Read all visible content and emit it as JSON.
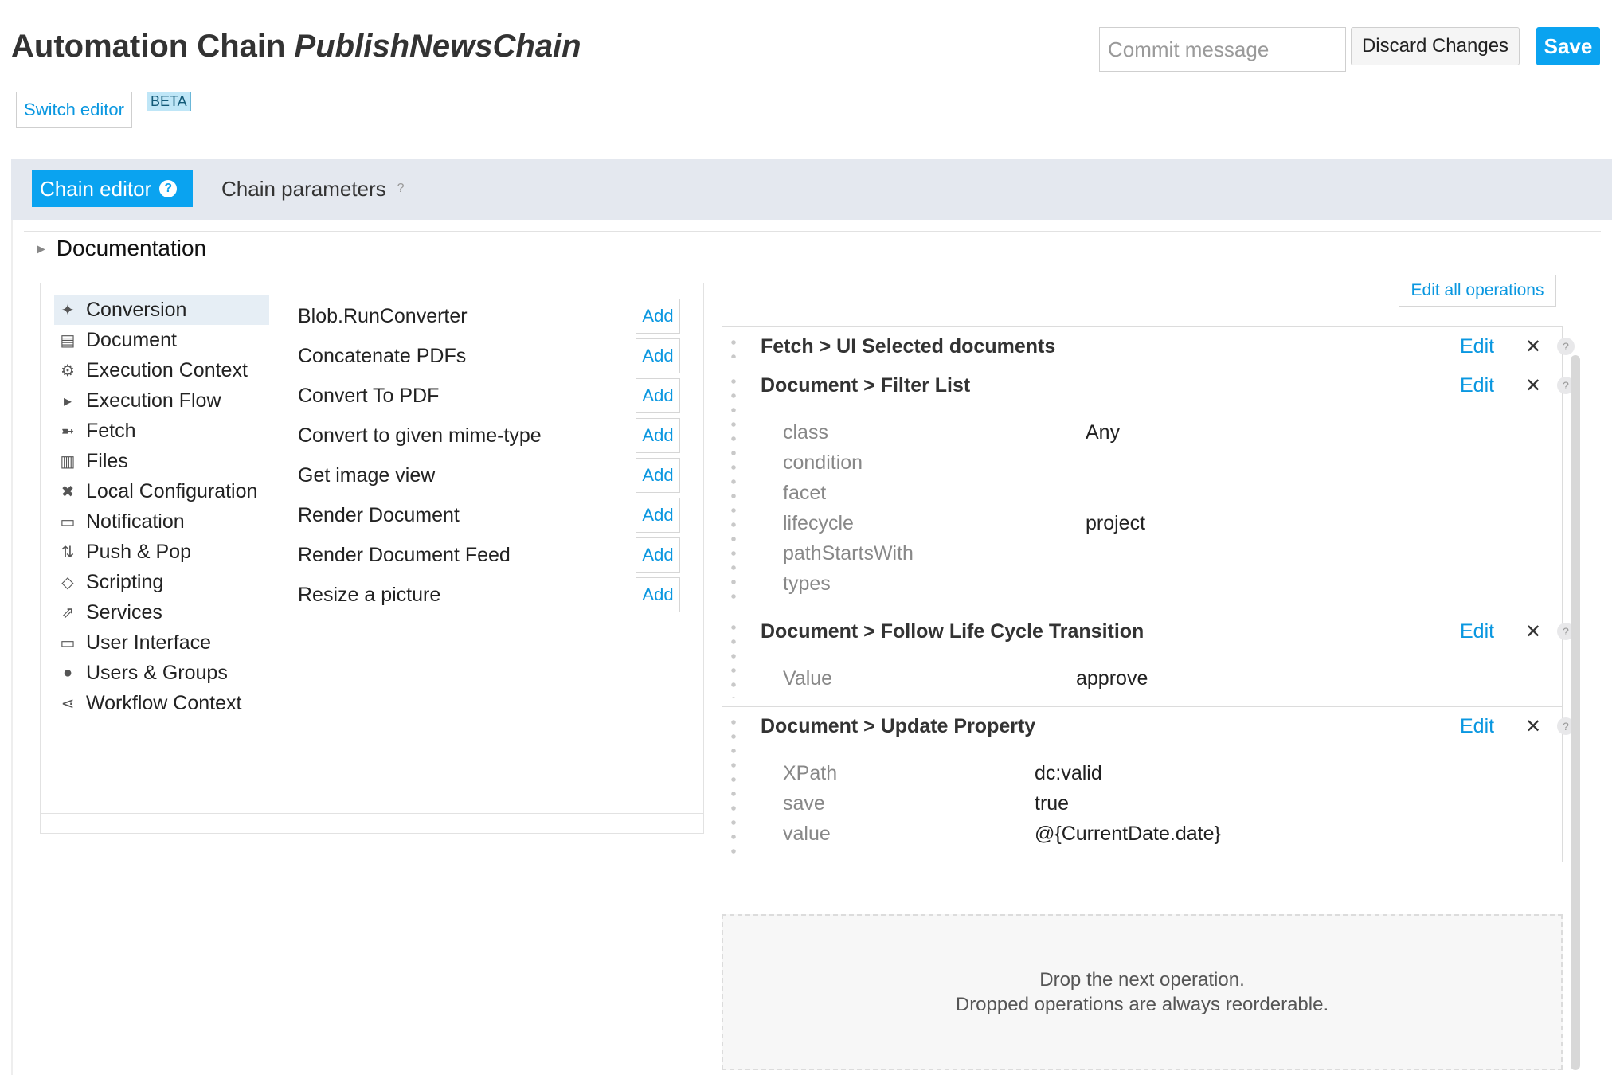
{
  "header": {
    "title_prefix": "Automation Chain",
    "chain_name": "PublishNewsChain",
    "switch_editor": "Switch editor",
    "beta": "BETA",
    "commit_placeholder": "Commit message",
    "discard": "Discard Changes",
    "save": "Save"
  },
  "tabs": {
    "chain_editor": "Chain editor",
    "chain_editor_help": "?",
    "chain_parameters": "Chain parameters",
    "chain_parameters_help": "?"
  },
  "documentation": {
    "arrow": "▶",
    "label": "Documentation"
  },
  "categories": [
    {
      "label": "Conversion",
      "icon": "magic-wand-icon",
      "active": true
    },
    {
      "label": "Document",
      "icon": "document-icon"
    },
    {
      "label": "Execution Context",
      "icon": "gear-icon"
    },
    {
      "label": "Execution Flow",
      "icon": "play-circle-icon"
    },
    {
      "label": "Fetch",
      "icon": "fetch-arrow-icon"
    },
    {
      "label": "Files",
      "icon": "files-icon"
    },
    {
      "label": "Local Configuration",
      "icon": "tools-icon"
    },
    {
      "label": "Notification",
      "icon": "speech-bubble-icon"
    },
    {
      "label": "Push & Pop",
      "icon": "push-pop-icon"
    },
    {
      "label": "Scripting",
      "icon": "script-icon"
    },
    {
      "label": "Services",
      "icon": "share-icon"
    },
    {
      "label": "User Interface",
      "icon": "monitor-icon"
    },
    {
      "label": "Users & Groups",
      "icon": "users-icon"
    },
    {
      "label": "Workflow Context",
      "icon": "workflow-icon"
    }
  ],
  "operations": {
    "add_label": "Add",
    "items": [
      "Blob.RunConverter",
      "Concatenate PDFs",
      "Convert To PDF",
      "Convert to given mime-type",
      "Get image view",
      "Render Document",
      "Render Document Feed",
      "Resize a picture"
    ]
  },
  "chain": {
    "edit_all": "Edit all operations",
    "edit_label": "Edit",
    "close_glyph": "✕",
    "help_glyph": "?",
    "ops": [
      {
        "title": "Fetch > UI Selected documents",
        "params": []
      },
      {
        "title": "Document > Filter List",
        "value_indent": "wide",
        "params": [
          {
            "name": "class",
            "value": "Any"
          },
          {
            "name": "condition",
            "value": ""
          },
          {
            "name": "facet",
            "value": ""
          },
          {
            "name": "lifecycle",
            "value": "project"
          },
          {
            "name": "pathStartsWith",
            "value": ""
          },
          {
            "name": "types",
            "value": ""
          }
        ]
      },
      {
        "title": "Document > Follow Life Cycle Transition",
        "value_indent": "medium",
        "params": [
          {
            "name": "Value",
            "value": "approve"
          }
        ]
      },
      {
        "title": "Document > Update Property",
        "value_indent": "narrow",
        "params": [
          {
            "name": "XPath",
            "value": "dc:valid"
          },
          {
            "name": "save",
            "value": "true"
          },
          {
            "name": "value",
            "value": "@{CurrentDate.date}"
          }
        ]
      }
    ],
    "drop_line1": "Drop the next operation.",
    "drop_line2": "Dropped operations are always reorderable."
  },
  "colors": {
    "accent": "#0aa3f0",
    "link": "#0a97e0",
    "tab_bar": "#e4e8ef"
  }
}
